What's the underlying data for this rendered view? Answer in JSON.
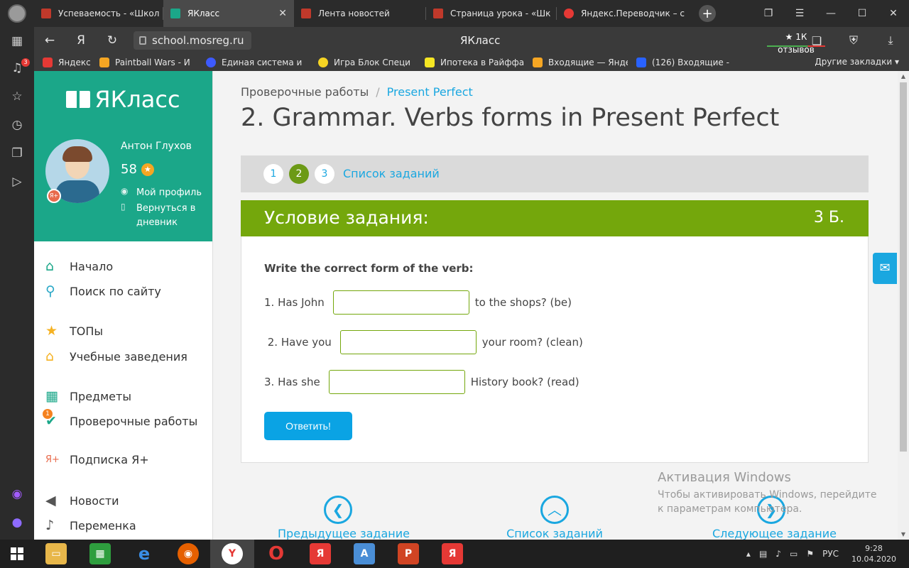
{
  "browser": {
    "tabs": [
      {
        "label": "Успеваемость - «Школ",
        "color": "#c0392b",
        "active": false
      },
      {
        "label": "ЯКласс",
        "color": "#1ba789",
        "active": true
      },
      {
        "label": "Лента новостей",
        "color": "#c0392b",
        "active": false
      },
      {
        "label": "Страница урока - «Шк",
        "color": "#c0392b",
        "active": false
      },
      {
        "label": "Яндекс.Переводчик – с",
        "color": "#e53935",
        "active": false
      }
    ],
    "tab_close": "✕",
    "new_tab": "+",
    "address": "school.mosreg.ru",
    "yandex_btn": "Я",
    "page_title": "ЯКласс",
    "reviews": "★ 1К отзывов",
    "notif_count": "3",
    "bookmarks": [
      {
        "label": "Яндекс",
        "color": "#e53935"
      },
      {
        "label": "Paintball Wars - И",
        "color": "#f5a623"
      },
      {
        "label": "Единая система и",
        "color": "#3d5afe"
      },
      {
        "label": "Игра Блок Специ",
        "color": "#f5d423"
      },
      {
        "label": "Ипотека в Райффа",
        "color": "#f5e623"
      },
      {
        "label": "Входящие — Янде",
        "color": "#f5a623"
      },
      {
        "label": "(126) Входящие - ",
        "color": "#2962ff"
      }
    ],
    "other_bookmarks": "Другие закладки ▾"
  },
  "sidebar": {
    "logo": "ЯКласс",
    "user_name": "Антон Глухов",
    "score": "58",
    "star": "★",
    "ybadge": "Я+",
    "profile_link": "Мой профиль",
    "diary_link": "Вернуться в дневник",
    "menu": [
      {
        "label": "Начало",
        "icon": "⌂"
      },
      {
        "label": "Поиск по сайту",
        "icon": "⚲"
      },
      {
        "label": "ТОПы",
        "icon": "★"
      },
      {
        "label": "Учебные заведения",
        "icon": "⌂"
      },
      {
        "label": "Предметы",
        "icon": "▦"
      },
      {
        "label": "Проверочные работы",
        "icon": "✔",
        "badge": "1"
      },
      {
        "label": "Подписка Я+",
        "icon": "Я+"
      },
      {
        "label": "Новости",
        "icon": "◀"
      },
      {
        "label": "Переменка",
        "icon": "♪"
      }
    ]
  },
  "content": {
    "breadcrumb_root": "Проверочные работы",
    "breadcrumb_sep": "/",
    "breadcrumb_current": "Present Perfect",
    "title": "2. Grammar. Verbs forms in Present Perfect",
    "steps": [
      "1",
      "2",
      "3"
    ],
    "task_list_link": "Список заданий",
    "task_header": "Условие задания:",
    "points": "3 Б.",
    "instruction": "Write the correct form of the verb:",
    "questions": [
      {
        "before": "1. Has John",
        "value": "",
        "after": "to the shops? (be)"
      },
      {
        "before": " 2. Have you",
        "value": "",
        "after": "your room? (clean)"
      },
      {
        "before": "3. Has she",
        "value": "",
        "after": "History book? (read)"
      }
    ],
    "submit": "Ответить!",
    "prev": "Предыдущее задание",
    "list": "Список заданий",
    "next": "Следующее задание"
  },
  "watermark": {
    "line1": "Активация Windows",
    "line2": "Чтобы активировать Windows, перейдите к параметрам компьютера."
  },
  "taskbar": {
    "lang": "РУС",
    "time": "9:28",
    "date": "10.04.2020"
  }
}
